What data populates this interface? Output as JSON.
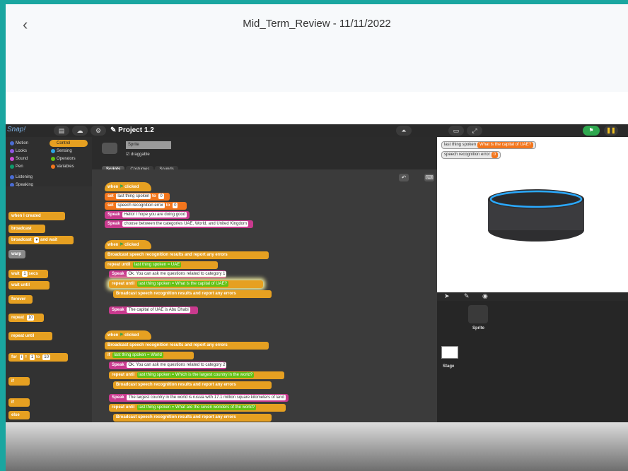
{
  "header": {
    "back_icon": "chevron-left-icon",
    "title": "Mid_Term_Review - 11/11/2022"
  },
  "snap": {
    "logo": "Snap!",
    "project_title": "Project 1.2",
    "categories": [
      {
        "label": "Motion",
        "color": "#4a6cd4"
      },
      {
        "label": "Control",
        "color": "#e6a021",
        "active": true
      },
      {
        "label": "Looks",
        "color": "#8f56e3"
      },
      {
        "label": "Sensing",
        "color": "#2ca5e2"
      },
      {
        "label": "Sound",
        "color": "#cf4ad9"
      },
      {
        "label": "Operators",
        "color": "#62c213"
      },
      {
        "label": "Pen",
        "color": "#0e9a6c"
      },
      {
        "label": "Variables",
        "color": "#f3761d"
      },
      {
        "label": "Listening",
        "color": "#4a6cd4"
      },
      {
        "label": "Speaking",
        "color": "#4a6cd4"
      }
    ],
    "palette": {
      "when_created": "when I created",
      "broadcast": "broadcast",
      "broadcast_wait": "broadcast",
      "and_wait": "and wait",
      "warp": "warp",
      "wait": "wait",
      "wait_value": "1",
      "secs": "secs",
      "wait_until": "wait until",
      "forever": "forever",
      "repeat": "repeat",
      "repeat_value": "10",
      "repeat_until": "repeat until",
      "for": "for",
      "for_i": "i",
      "for_eq": "=",
      "for_from": "1",
      "for_to": "to",
      "for_end": "10",
      "if": "if",
      "else": "else"
    },
    "sprite": {
      "name": "Sprite",
      "draggable": "draggable"
    },
    "tabs": [
      "Scripts",
      "Costumes",
      "Sounds"
    ],
    "script1": {
      "hat": "when",
      "hat_clicked": "clicked",
      "set1": "set",
      "set1_var": "last thing spoken",
      "set1_to": "to",
      "set1_val": "0",
      "set2": "set",
      "set2_var": "speech recognition error",
      "set2_to": "to",
      "set2_val": "0",
      "speak1": "Speak",
      "speak1_text": "Hello! I hope you are doing good",
      "speak2": "Speak",
      "speak2_text": "choose between the categories UAE, World, and United Kingdom"
    },
    "script2": {
      "hat": "when",
      "hat_clicked": "clicked",
      "broadcast": "Broadcast speech recognition results and report any errors",
      "repeat_until": "repeat until",
      "cond_var": "last thing spoken",
      "cond_eq": "=",
      "cond_val": "UAE",
      "speak1": "Speak",
      "speak1_text": "Ok. You can ask me questions related to category 1",
      "inner_repeat": "repeat until",
      "inner_var": "last thing spoken",
      "inner_eq": "=",
      "inner_val": "What is the capital of UAE?",
      "inner_broadcast": "Broadcast speech recognition results and report any errors",
      "speak2": "Speak",
      "speak2_text": "The capital of UAE is Abu Dhabi"
    },
    "script3": {
      "hat": "when",
      "hat_clicked": "clicked",
      "broadcast": "Broadcast speech recognition results and report any errors",
      "if": "if",
      "cond_var": "last thing spoken",
      "cond_eq": "=",
      "cond_val": "World",
      "speak1": "Speak",
      "speak1_text": "Ok. You can ask me questions related to category 2",
      "repeat1": "repeat until",
      "repeat1_var": "last thing spoken",
      "repeat1_eq": "=",
      "repeat1_val": "Which is the largest country in the world?",
      "broadcast2": "Broadcast speech recognition results and report any errors",
      "speak2": "Speak",
      "speak2_text": "The largest country in the world is russia with 17.1 million square kilometers of land",
      "repeat2": "repeat until",
      "repeat2_var": "last thing spoken",
      "repeat2_eq": "=",
      "repeat2_val": "What are the seven wonders of the world?",
      "broadcast3": "Broadcast speech recognition results and report any errors"
    },
    "watchers": [
      {
        "label": "last thing spoken",
        "value": "What is the capital of UAE?"
      },
      {
        "label": "speech recognition error",
        "value": "0"
      }
    ],
    "corral": {
      "sprite_label": "Sprite",
      "stage_label": "Stage"
    }
  }
}
